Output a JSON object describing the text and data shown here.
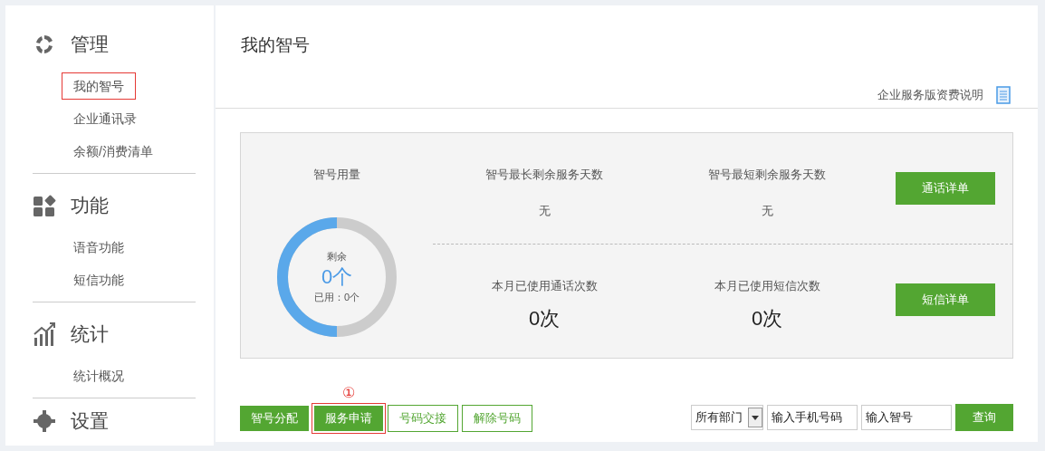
{
  "sidebar": {
    "sections": [
      {
        "title": "管理",
        "items": [
          {
            "label": "我的智号",
            "highlighted": true
          },
          {
            "label": "企业通讯录",
            "highlighted": false
          },
          {
            "label": "余额/消费清单",
            "highlighted": false
          }
        ]
      },
      {
        "title": "功能",
        "items": [
          {
            "label": "语音功能",
            "highlighted": false
          },
          {
            "label": "短信功能",
            "highlighted": false
          }
        ]
      },
      {
        "title": "统计",
        "items": [
          {
            "label": "统计概况",
            "highlighted": false
          }
        ]
      },
      {
        "title": "设置"
      }
    ]
  },
  "page_title": "我的智号",
  "pricing_link": "企业服务版资费说明",
  "usage": {
    "title": "智号用量",
    "center_label": "剩余",
    "remaining": "0个",
    "used": "已用：0个",
    "level": 0.5
  },
  "stats": [
    {
      "label": "智号最长剩余服务天数",
      "value": "无"
    },
    {
      "label": "智号最短剩余服务天数",
      "value": "无"
    },
    {
      "label": "本月已使用通话次数",
      "value": "0次"
    },
    {
      "label": "本月已使用短信次数",
      "value": "0次"
    }
  ],
  "detail_buttons": [
    "通话详单",
    "短信详单"
  ],
  "actions": [
    {
      "label": "智号分配",
      "kind": "filled",
      "highlighted": false
    },
    {
      "label": "服务申请",
      "kind": "filled",
      "highlighted": true,
      "marker": "①"
    },
    {
      "label": "号码交接",
      "kind": "outline",
      "highlighted": false
    },
    {
      "label": "解除号码",
      "kind": "outline",
      "highlighted": false
    }
  ],
  "filters": {
    "department": "所有部门",
    "phone_placeholder": "输入手机号码",
    "number_placeholder": "输入智号",
    "search_button": "查询"
  }
}
